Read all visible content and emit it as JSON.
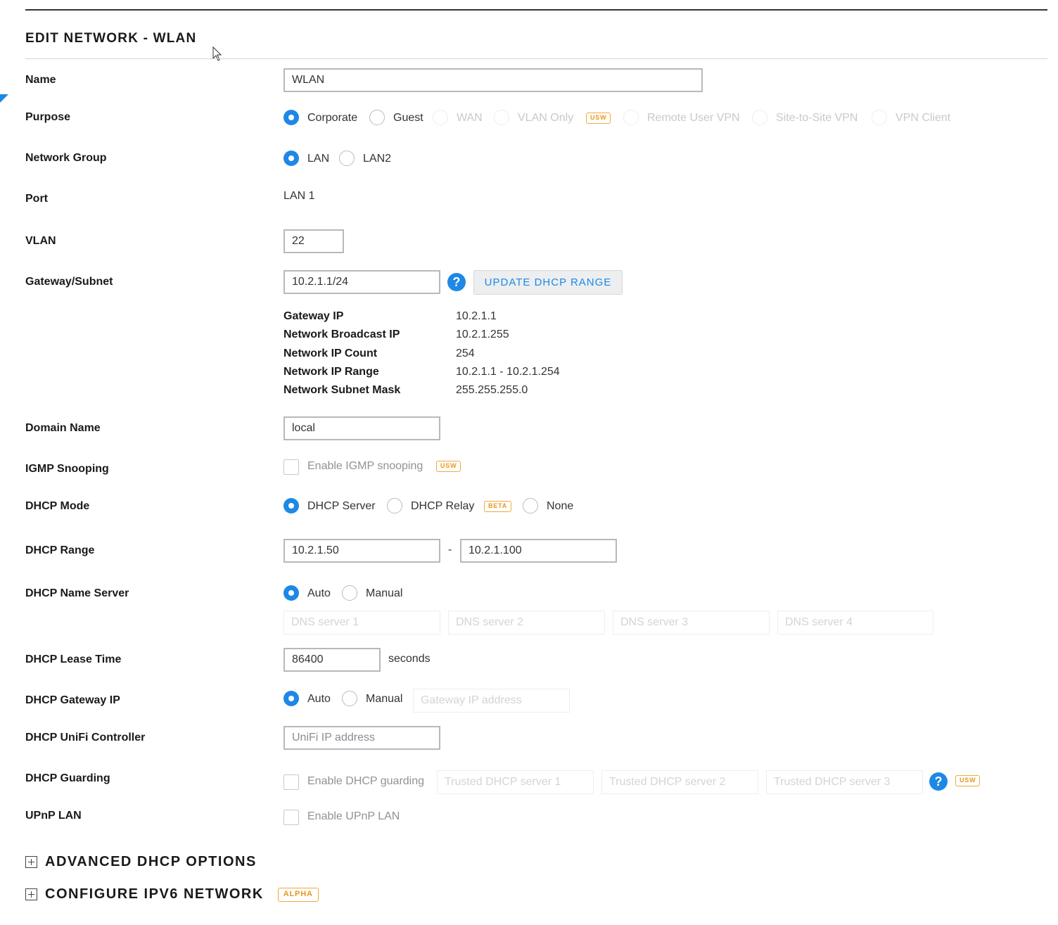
{
  "page": {
    "title": "EDIT NETWORK - WLAN"
  },
  "labels": {
    "name": "Name",
    "purpose": "Purpose",
    "network_group": "Network Group",
    "port": "Port",
    "vlan": "VLAN",
    "gateway_subnet": "Gateway/Subnet",
    "domain_name": "Domain Name",
    "igmp_snooping": "IGMP Snooping",
    "dhcp_mode": "DHCP Mode",
    "dhcp_range": "DHCP Range",
    "dhcp_name_server": "DHCP Name Server",
    "dhcp_lease_time": "DHCP Lease Time",
    "dhcp_gateway_ip": "DHCP Gateway IP",
    "dhcp_unifi_controller": "DHCP UniFi Controller",
    "dhcp_guarding": "DHCP Guarding",
    "upnp_lan": "UPnP LAN"
  },
  "name_value": "WLAN",
  "purpose_options": {
    "corporate": "Corporate",
    "guest": "Guest",
    "wan": "WAN",
    "vlan_only": "VLAN Only",
    "remote_user_vpn": "Remote User VPN",
    "site_to_site_vpn": "Site-to-Site VPN",
    "vpn_client": "VPN Client",
    "selected": "Corporate"
  },
  "network_group_options": {
    "lan": "LAN",
    "lan2": "LAN2",
    "selected": "LAN"
  },
  "port_value": "LAN 1",
  "vlan_value": "22",
  "gateway_subnet_value": "10.2.1.1/24",
  "update_dhcp_button": "UPDATE DHCP RANGE",
  "help_glyph": "?",
  "subnet_info": [
    {
      "key": "Gateway IP",
      "value": "10.2.1.1"
    },
    {
      "key": "Network Broadcast IP",
      "value": "10.2.1.255"
    },
    {
      "key": "Network IP Count",
      "value": "254"
    },
    {
      "key": "Network IP Range",
      "value": "10.2.1.1 - 10.2.1.254"
    },
    {
      "key": "Network Subnet Mask",
      "value": "255.255.255.0"
    }
  ],
  "domain_name_value": "local",
  "igmp_checkbox_label": "Enable IGMP snooping",
  "dhcp_mode_options": {
    "server": "DHCP Server",
    "relay": "DHCP Relay",
    "none": "None",
    "selected": "DHCP Server"
  },
  "dhcp_range": {
    "start": "10.2.1.50",
    "separator": "-",
    "end": "10.2.1.100"
  },
  "name_server_options": {
    "auto": "Auto",
    "manual": "Manual",
    "selected": "Auto"
  },
  "dns_placeholders": [
    "DNS server 1",
    "DNS server 2",
    "DNS server 3",
    "DNS server 4"
  ],
  "lease_time": {
    "value": "86400",
    "unit": "seconds"
  },
  "gateway_ip_options": {
    "auto": "Auto",
    "manual": "Manual",
    "selected": "Auto",
    "placeholder": "Gateway IP address"
  },
  "unifi_controller_placeholder": "UniFi IP address",
  "dhcp_guarding": {
    "checkbox_label": "Enable DHCP guarding",
    "placeholders": [
      "Trusted DHCP server 1",
      "Trusted DHCP server 2",
      "Trusted DHCP server 3"
    ]
  },
  "upnp_checkbox_label": "Enable UPnP LAN",
  "badges": {
    "usw": "USW",
    "beta": "BETA",
    "alpha": "ALPHA"
  },
  "sections": {
    "advanced_dhcp": "ADVANCED DHCP OPTIONS",
    "ipv6": "CONFIGURE IPV6 NETWORK"
  },
  "colors": {
    "accent": "#1e88e5",
    "badge": "#f1a93a",
    "text": "#1a1a1a"
  }
}
